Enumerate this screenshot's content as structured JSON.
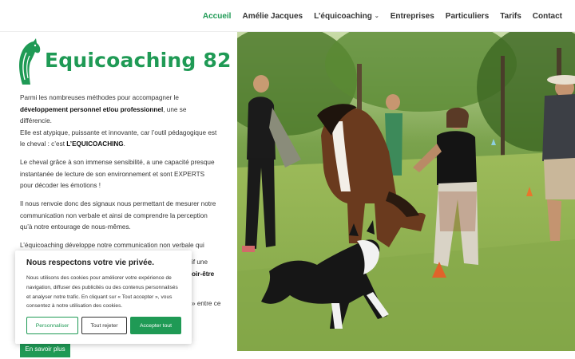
{
  "nav": {
    "items": [
      {
        "label": "Accueil",
        "active": true
      },
      {
        "label": "Amélie Jacques",
        "active": false
      },
      {
        "label": "L’équicoaching",
        "active": false,
        "dropdown": true
      },
      {
        "label": "Entreprises",
        "active": false
      },
      {
        "label": "Particuliers",
        "active": false
      },
      {
        "label": "Tarifs",
        "active": false
      },
      {
        "label": "Contact",
        "active": false
      }
    ]
  },
  "logo": {
    "text": "Equicoaching 82",
    "icon": "horse-head-icon"
  },
  "content": {
    "p1_a": "Parmi les nombreuses méthodes pour accompagner le ",
    "p1_b": "développement personnel et/ou professionnel",
    "p1_c": ", une se différencie.",
    "p1_d": "Elle est atypique, puissante et innovante, car l’outil pédagogique est le cheval : c’est ",
    "p1_e": "L’EQUICOACHING",
    "p1_f": ".",
    "p2": "Le cheval grâce à son immense sensibilité, a une capacité presque instantanée de lecture de son environnement et sont  EXPERTS pour décoder les émotions !",
    "p3": "Il nous renvoie donc des signaux nous permettant de mesurer notre communication non verbale et ainsi de comprendre la perception qu’à notre entourage de nous-mêmes.",
    "p4": "L’équicoaching développe notre communication non verbale qui représente quand même 80% de notre communication !",
    "frag1": "if une",
    "frag2": "oir-être",
    "frag3": "» entre ce",
    "more_label": "En savoir plus"
  },
  "cookie": {
    "title": "Nous respectons votre vie privée.",
    "text": "Nous utilisons des cookies pour améliorer votre expérience de navigation, diffuser des publicités ou des contenus personnalisés et analyser notre trafic. En cliquant sur « Tout accepter », vous consentez à notre utilisation des cookies.",
    "customize": "Personnaliser",
    "reject": "Tout rejeter",
    "accept": "Accepter tout"
  },
  "colors": {
    "brand": "#1f9a55"
  }
}
